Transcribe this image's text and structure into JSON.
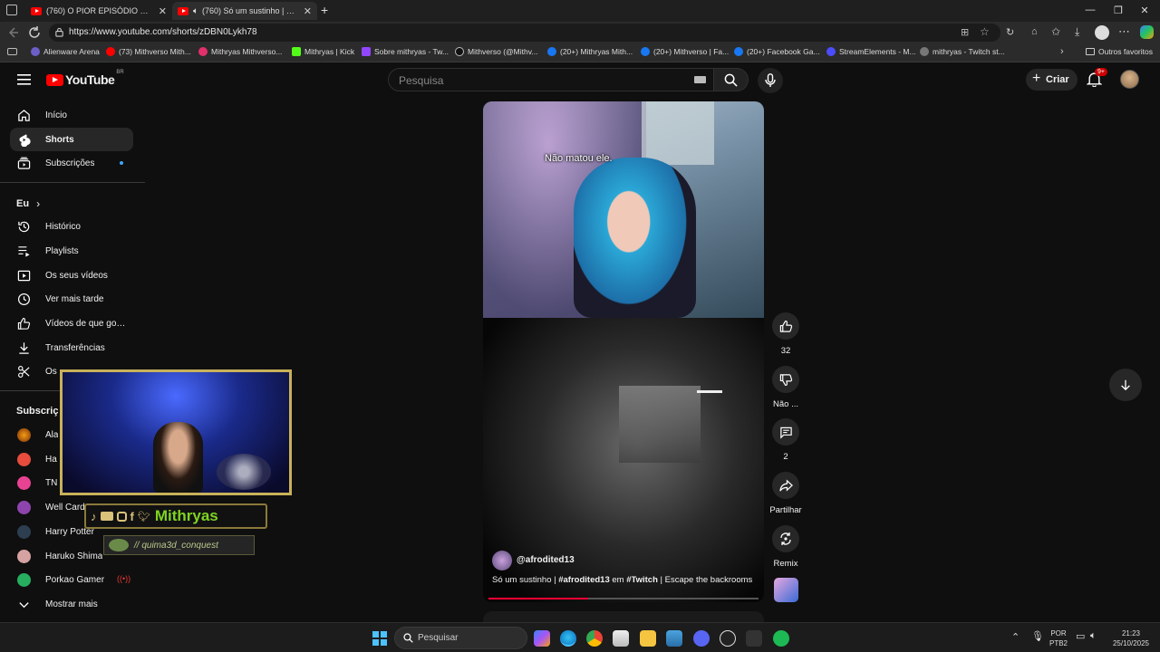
{
  "browser": {
    "tabs": [
      {
        "title": "(760) O PIOR EPISÓDIO DE ONE P"
      },
      {
        "title": "(760) Só um sustinho | #afro"
      }
    ],
    "url": "https://www.youtube.com/shorts/zDBN0Lykh78",
    "bookmarks": [
      {
        "label": "Alienware Arena"
      },
      {
        "label": "(73) Mithverso Mith..."
      },
      {
        "label": "Mithryas Mithverso..."
      },
      {
        "label": "Mithryas | Kick"
      },
      {
        "label": "Sobre mithryas - Tw..."
      },
      {
        "label": "Mithverso (@Mithv..."
      },
      {
        "label": "(20+) Mithryas Mith..."
      },
      {
        "label": "(20+) Mithverso | Fa..."
      },
      {
        "label": "(20+) Facebook Ga..."
      },
      {
        "label": "StreamElements - M..."
      },
      {
        "label": "mithryas - Twitch st..."
      }
    ],
    "other_favorites": "Outros favoritos"
  },
  "youtube": {
    "logo_text": "YouTube",
    "region": "BR",
    "search_placeholder": "Pesquisa",
    "create_label": "Criar",
    "notif_count": "9+",
    "sidebar": {
      "main": [
        {
          "label": "Início",
          "icon": "home-icon"
        },
        {
          "label": "Shorts",
          "icon": "shorts-icon"
        },
        {
          "label": "Subscrições",
          "icon": "subscriptions-icon"
        }
      ],
      "you_header": "Eu",
      "you": [
        {
          "label": "Histórico",
          "icon": "history-icon"
        },
        {
          "label": "Playlists",
          "icon": "playlists-icon"
        },
        {
          "label": "Os seus vídeos",
          "icon": "your-videos-icon"
        },
        {
          "label": "Ver mais tarde",
          "icon": "watch-later-icon"
        },
        {
          "label": "Vídeos de que gost...",
          "icon": "liked-icon"
        },
        {
          "label": "Transferências",
          "icon": "download-icon"
        },
        {
          "label": "Os",
          "icon": "clips-icon"
        }
      ],
      "subs_header": "Subscriç",
      "subscriptions": [
        {
          "label": "Ala",
          "color": "#c0392b"
        },
        {
          "label": "Ha",
          "color": "#e74c3c"
        },
        {
          "label": "TN",
          "color": "#e84393"
        },
        {
          "label": "Well Card",
          "color": "#8e44ad"
        },
        {
          "label": "Harry Potter",
          "color": "#2c3e50"
        },
        {
          "label": "Haruko Shima",
          "color": "#d6a2a2"
        },
        {
          "label": "Porkao Gamer",
          "color": "#27ae60"
        }
      ],
      "show_more": "Mostrar mais"
    },
    "short": {
      "caption": "Não matou ele.",
      "channel": "@afrodited13",
      "title_pre": "Só um sustinho | ",
      "title_tag1": "#afrodited13",
      "title_mid": " em ",
      "title_tag2": "#Twitch",
      "title_post": " | Escape the backrooms",
      "progress": 0.37
    },
    "actions": {
      "likes": "32",
      "dislike": "Não ...",
      "comments": "2",
      "share": "Partilhar",
      "remix": "Remix"
    },
    "overlay": {
      "name": "Mithryas",
      "quest": "// quima3d_conquest"
    }
  },
  "taskbar": {
    "search": "Pesquisar",
    "lang1": "POR",
    "lang2": "PTB2",
    "time": "21:23",
    "date": "25/10/2025"
  }
}
